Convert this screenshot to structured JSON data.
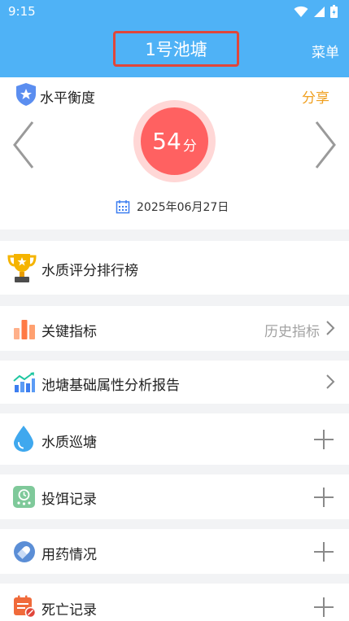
{
  "status_bar": {
    "time": "9:15"
  },
  "header": {
    "title": "1号池塘",
    "menu": "菜单"
  },
  "score_card": {
    "level_label": "水平衡度",
    "share": "分享",
    "score_value": "54",
    "score_unit": "分",
    "date": "2025年06月27日"
  },
  "rows": {
    "ranking": "水质评分排行榜",
    "key_indicators": "关键指标",
    "history_indicators": "历史指标",
    "pond_report": "池塘基础属性分析报告",
    "water_patrol": "水质巡塘",
    "feeding_record": "投饵记录",
    "medication": "用药情况",
    "death_record": "死亡记录"
  },
  "colors": {
    "header": "#4fb2f6",
    "accent_orange": "#f0a020",
    "score_red": "#ff6161"
  }
}
